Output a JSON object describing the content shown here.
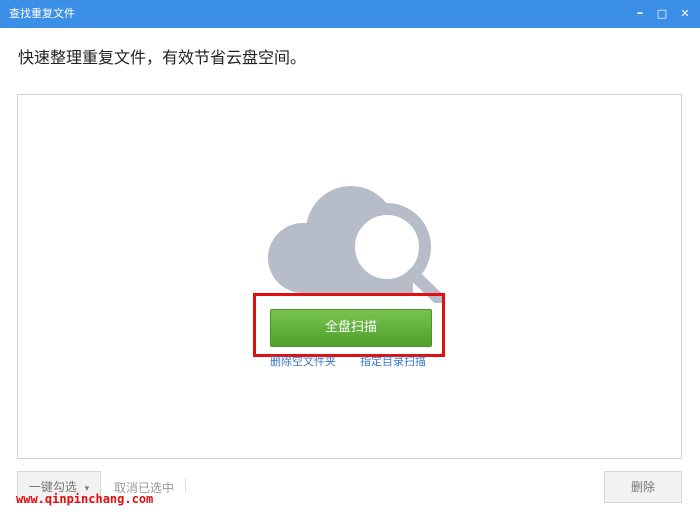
{
  "window": {
    "title": "查找重复文件",
    "minimize_glyph": "–",
    "maximize_glyph": "□",
    "close_glyph": "✕"
  },
  "headline": "快速整理重复文件，有效节省云盘空间。",
  "main": {
    "scan_button": "全盘扫描",
    "links": {
      "delete_empty": "删除空文件夹",
      "scan_dir": "指定目录扫描"
    }
  },
  "footer": {
    "select_all": "一键勾选",
    "select_all_caret": "▾",
    "deselect": "取消已选中",
    "delete": "删除"
  },
  "watermark": "www.qinpinchang.com",
  "colors": {
    "titlebar": "#3c8fe6",
    "scan_button": "#5aab35",
    "highlight": "#e01010",
    "link": "#3a78c8"
  }
}
